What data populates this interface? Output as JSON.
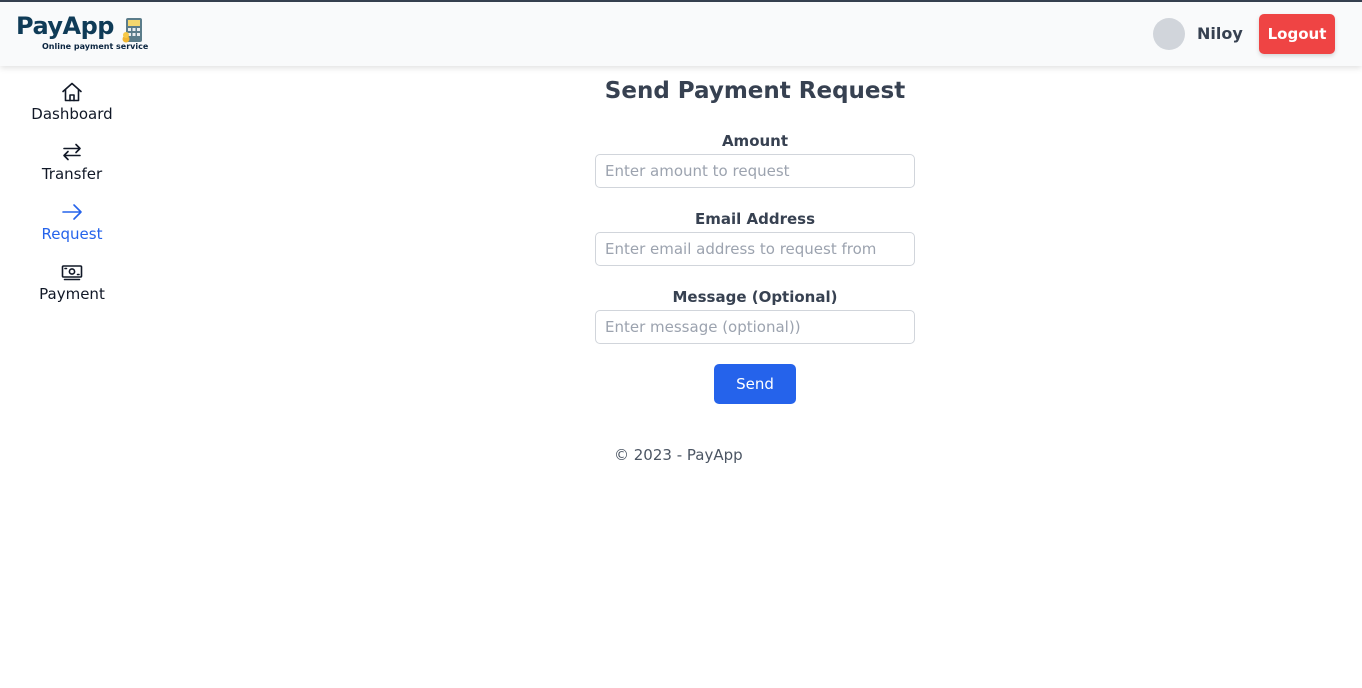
{
  "header": {
    "logo_title": "PayApp",
    "logo_subtitle": "Online payment service",
    "logo_icon": "payment-terminal-icon",
    "username": "Niloy",
    "logout_label": "Logout",
    "logout_color": "#ef4444"
  },
  "sidebar": {
    "items": [
      {
        "label": "Dashboard",
        "icon": "home-icon",
        "active": false
      },
      {
        "label": "Transfer",
        "icon": "arrows-swap-icon",
        "active": false
      },
      {
        "label": "Request",
        "icon": "arrow-right-icon",
        "active": true
      },
      {
        "label": "Payment",
        "icon": "banknote-icon",
        "active": false
      }
    ],
    "active_color": "#2563eb"
  },
  "main": {
    "title": "Send Payment Request",
    "fields": [
      {
        "label": "Amount",
        "placeholder": "Enter amount to request",
        "value": ""
      },
      {
        "label": "Email Address",
        "placeholder": "Enter email address to request from",
        "value": ""
      },
      {
        "label": "Message (Optional)",
        "placeholder": "Enter message (optional))",
        "value": ""
      }
    ],
    "send_label": "Send",
    "send_color": "#2563eb"
  },
  "footer": {
    "text": "© 2023 - PayApp"
  }
}
